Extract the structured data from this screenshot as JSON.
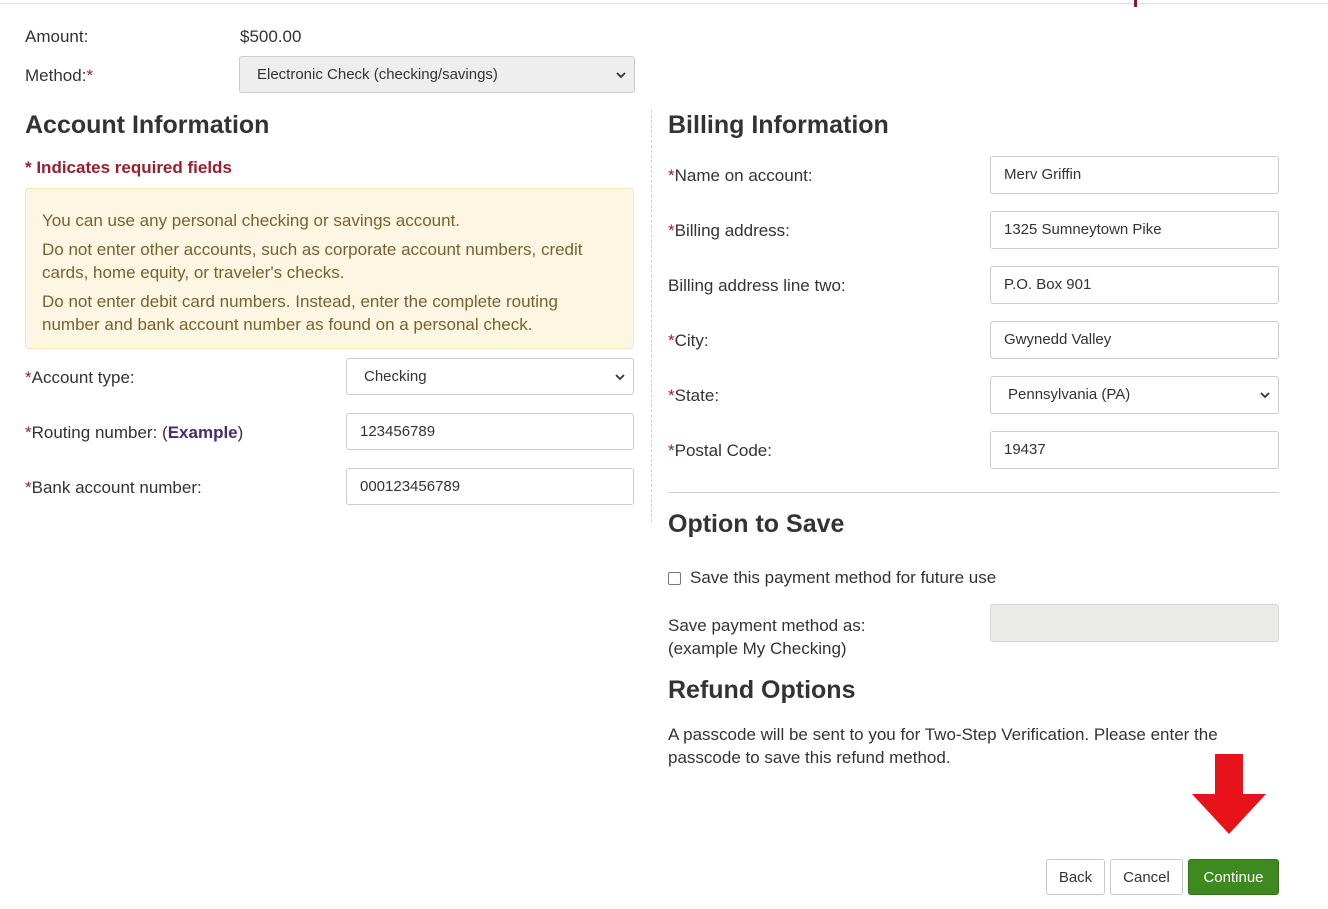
{
  "payment": {
    "amount_label": "Amount:",
    "amount_value": "$500.00",
    "method_label": "Method:",
    "method_required": "*",
    "method_value": "Electronic Check (checking/savings)"
  },
  "account_info": {
    "heading": "Account Information",
    "required_note": "* Indicates required fields",
    "notice_lines": [
      "You can use any personal checking or savings account.",
      "Do not enter other accounts, such as corporate account numbers, credit cards, home equity, or traveler's checks.",
      "Do not enter debit card numbers. Instead, enter the complete routing number and bank account number as found on a personal check."
    ],
    "account_type_label": "Account type:",
    "account_type_value": "Checking",
    "routing_label": "Routing number: (",
    "routing_link": "Example",
    "routing_close": ")",
    "routing_value": "123456789",
    "bank_account_label": "Bank account number:",
    "bank_account_value": "000123456789"
  },
  "billing_info": {
    "heading": "Billing Information",
    "name_label": "Name on account:",
    "name_value": "Merv Griffin",
    "address_label": "Billing address:",
    "address_value": "1325 Sumneytown Pike",
    "address2_label": "Billing address line two:",
    "address2_value": "P.O. Box 901",
    "city_label": "City:",
    "city_value": "Gwynedd Valley",
    "state_label": "State:",
    "state_value": "Pennsylvania (PA)",
    "postal_label": "Postal Code:",
    "postal_value": "19437"
  },
  "required_mark": "*",
  "option_to_save": {
    "heading": "Option to Save",
    "checkbox_label": "Save this payment method for future use",
    "checkbox_checked": false,
    "save_as_label": "Save payment method as:",
    "save_as_hint": "(example My Checking)",
    "save_as_value": ""
  },
  "refund_options": {
    "heading": "Refund Options",
    "text": "A passcode will be sent to you for Two-Step Verification. Please enter the passcode to save this refund method."
  },
  "buttons": {
    "back": "Back",
    "cancel": "Cancel",
    "continue": "Continue"
  },
  "colors": {
    "required": "#a01c2a",
    "primary_button": "#3e8a1f",
    "arrow": "#e8121a",
    "notice_bg": "#fcf6e2"
  },
  "icons": {
    "select_caret": "chevron-down-icon",
    "annotation_arrow": "arrow-down-icon"
  }
}
